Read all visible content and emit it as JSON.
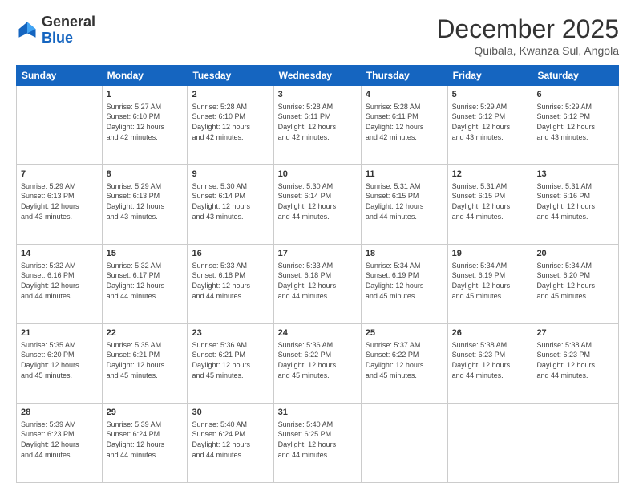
{
  "header": {
    "logo_general": "General",
    "logo_blue": "Blue",
    "month_title": "December 2025",
    "subtitle": "Quibala, Kwanza Sul, Angola"
  },
  "weekdays": [
    "Sunday",
    "Monday",
    "Tuesday",
    "Wednesday",
    "Thursday",
    "Friday",
    "Saturday"
  ],
  "weeks": [
    [
      {
        "day": "",
        "info": ""
      },
      {
        "day": "1",
        "info": "Sunrise: 5:27 AM\nSunset: 6:10 PM\nDaylight: 12 hours\nand 42 minutes."
      },
      {
        "day": "2",
        "info": "Sunrise: 5:28 AM\nSunset: 6:10 PM\nDaylight: 12 hours\nand 42 minutes."
      },
      {
        "day": "3",
        "info": "Sunrise: 5:28 AM\nSunset: 6:11 PM\nDaylight: 12 hours\nand 42 minutes."
      },
      {
        "day": "4",
        "info": "Sunrise: 5:28 AM\nSunset: 6:11 PM\nDaylight: 12 hours\nand 42 minutes."
      },
      {
        "day": "5",
        "info": "Sunrise: 5:29 AM\nSunset: 6:12 PM\nDaylight: 12 hours\nand 43 minutes."
      },
      {
        "day": "6",
        "info": "Sunrise: 5:29 AM\nSunset: 6:12 PM\nDaylight: 12 hours\nand 43 minutes."
      }
    ],
    [
      {
        "day": "7",
        "info": "Sunrise: 5:29 AM\nSunset: 6:13 PM\nDaylight: 12 hours\nand 43 minutes."
      },
      {
        "day": "8",
        "info": "Sunrise: 5:29 AM\nSunset: 6:13 PM\nDaylight: 12 hours\nand 43 minutes."
      },
      {
        "day": "9",
        "info": "Sunrise: 5:30 AM\nSunset: 6:14 PM\nDaylight: 12 hours\nand 43 minutes."
      },
      {
        "day": "10",
        "info": "Sunrise: 5:30 AM\nSunset: 6:14 PM\nDaylight: 12 hours\nand 44 minutes."
      },
      {
        "day": "11",
        "info": "Sunrise: 5:31 AM\nSunset: 6:15 PM\nDaylight: 12 hours\nand 44 minutes."
      },
      {
        "day": "12",
        "info": "Sunrise: 5:31 AM\nSunset: 6:15 PM\nDaylight: 12 hours\nand 44 minutes."
      },
      {
        "day": "13",
        "info": "Sunrise: 5:31 AM\nSunset: 6:16 PM\nDaylight: 12 hours\nand 44 minutes."
      }
    ],
    [
      {
        "day": "14",
        "info": "Sunrise: 5:32 AM\nSunset: 6:16 PM\nDaylight: 12 hours\nand 44 minutes."
      },
      {
        "day": "15",
        "info": "Sunrise: 5:32 AM\nSunset: 6:17 PM\nDaylight: 12 hours\nand 44 minutes."
      },
      {
        "day": "16",
        "info": "Sunrise: 5:33 AM\nSunset: 6:18 PM\nDaylight: 12 hours\nand 44 minutes."
      },
      {
        "day": "17",
        "info": "Sunrise: 5:33 AM\nSunset: 6:18 PM\nDaylight: 12 hours\nand 44 minutes."
      },
      {
        "day": "18",
        "info": "Sunrise: 5:34 AM\nSunset: 6:19 PM\nDaylight: 12 hours\nand 45 minutes."
      },
      {
        "day": "19",
        "info": "Sunrise: 5:34 AM\nSunset: 6:19 PM\nDaylight: 12 hours\nand 45 minutes."
      },
      {
        "day": "20",
        "info": "Sunrise: 5:34 AM\nSunset: 6:20 PM\nDaylight: 12 hours\nand 45 minutes."
      }
    ],
    [
      {
        "day": "21",
        "info": "Sunrise: 5:35 AM\nSunset: 6:20 PM\nDaylight: 12 hours\nand 45 minutes."
      },
      {
        "day": "22",
        "info": "Sunrise: 5:35 AM\nSunset: 6:21 PM\nDaylight: 12 hours\nand 45 minutes."
      },
      {
        "day": "23",
        "info": "Sunrise: 5:36 AM\nSunset: 6:21 PM\nDaylight: 12 hours\nand 45 minutes."
      },
      {
        "day": "24",
        "info": "Sunrise: 5:36 AM\nSunset: 6:22 PM\nDaylight: 12 hours\nand 45 minutes."
      },
      {
        "day": "25",
        "info": "Sunrise: 5:37 AM\nSunset: 6:22 PM\nDaylight: 12 hours\nand 45 minutes."
      },
      {
        "day": "26",
        "info": "Sunrise: 5:38 AM\nSunset: 6:23 PM\nDaylight: 12 hours\nand 44 minutes."
      },
      {
        "day": "27",
        "info": "Sunrise: 5:38 AM\nSunset: 6:23 PM\nDaylight: 12 hours\nand 44 minutes."
      }
    ],
    [
      {
        "day": "28",
        "info": "Sunrise: 5:39 AM\nSunset: 6:23 PM\nDaylight: 12 hours\nand 44 minutes."
      },
      {
        "day": "29",
        "info": "Sunrise: 5:39 AM\nSunset: 6:24 PM\nDaylight: 12 hours\nand 44 minutes."
      },
      {
        "day": "30",
        "info": "Sunrise: 5:40 AM\nSunset: 6:24 PM\nDaylight: 12 hours\nand 44 minutes."
      },
      {
        "day": "31",
        "info": "Sunrise: 5:40 AM\nSunset: 6:25 PM\nDaylight: 12 hours\nand 44 minutes."
      },
      {
        "day": "",
        "info": ""
      },
      {
        "day": "",
        "info": ""
      },
      {
        "day": "",
        "info": ""
      }
    ]
  ]
}
